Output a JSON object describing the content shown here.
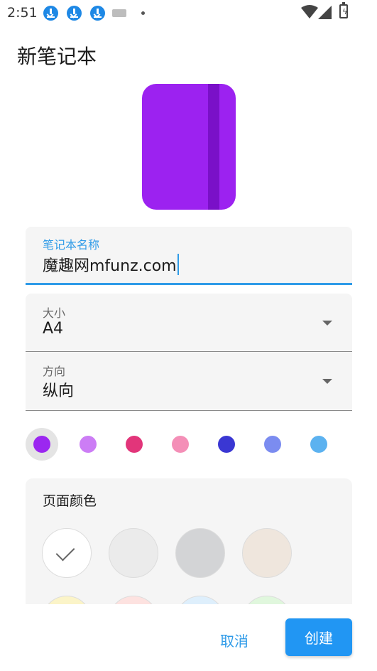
{
  "status_bar": {
    "time": "2:51",
    "icons": [
      "download-icon",
      "download-icon",
      "download-icon",
      "keyboard-icon",
      "dot-icon",
      "wifi-icon",
      "signal-icon",
      "battery-charging-icon"
    ]
  },
  "page_title": "新笔记本",
  "cover": {
    "color": "#9c22f0",
    "spine_color": "#7a10c8"
  },
  "name_field": {
    "label": "笔记本名称",
    "value": "魔趣网mfunz.com"
  },
  "size_field": {
    "label": "大小",
    "value": "A4"
  },
  "orientation_field": {
    "label": "方向",
    "value": "纵向"
  },
  "cover_colors": {
    "selected_index": 0,
    "colors": [
      "#9b27f0",
      "#cc7df5",
      "#e2357a",
      "#f48fb7",
      "#3a37d3",
      "#7b8cf0",
      "#5cb2f0"
    ]
  },
  "page_colors": {
    "label": "页面颜色",
    "selected_index": 0,
    "colors": [
      "#ffffff",
      "#ebebeb",
      "#d3d4d6",
      "#efe6dd",
      "#fbf4c8",
      "#fde2e0",
      "#deeffc",
      "#e0f7dd"
    ]
  },
  "actions": {
    "cancel": "取消",
    "create": "创建"
  }
}
